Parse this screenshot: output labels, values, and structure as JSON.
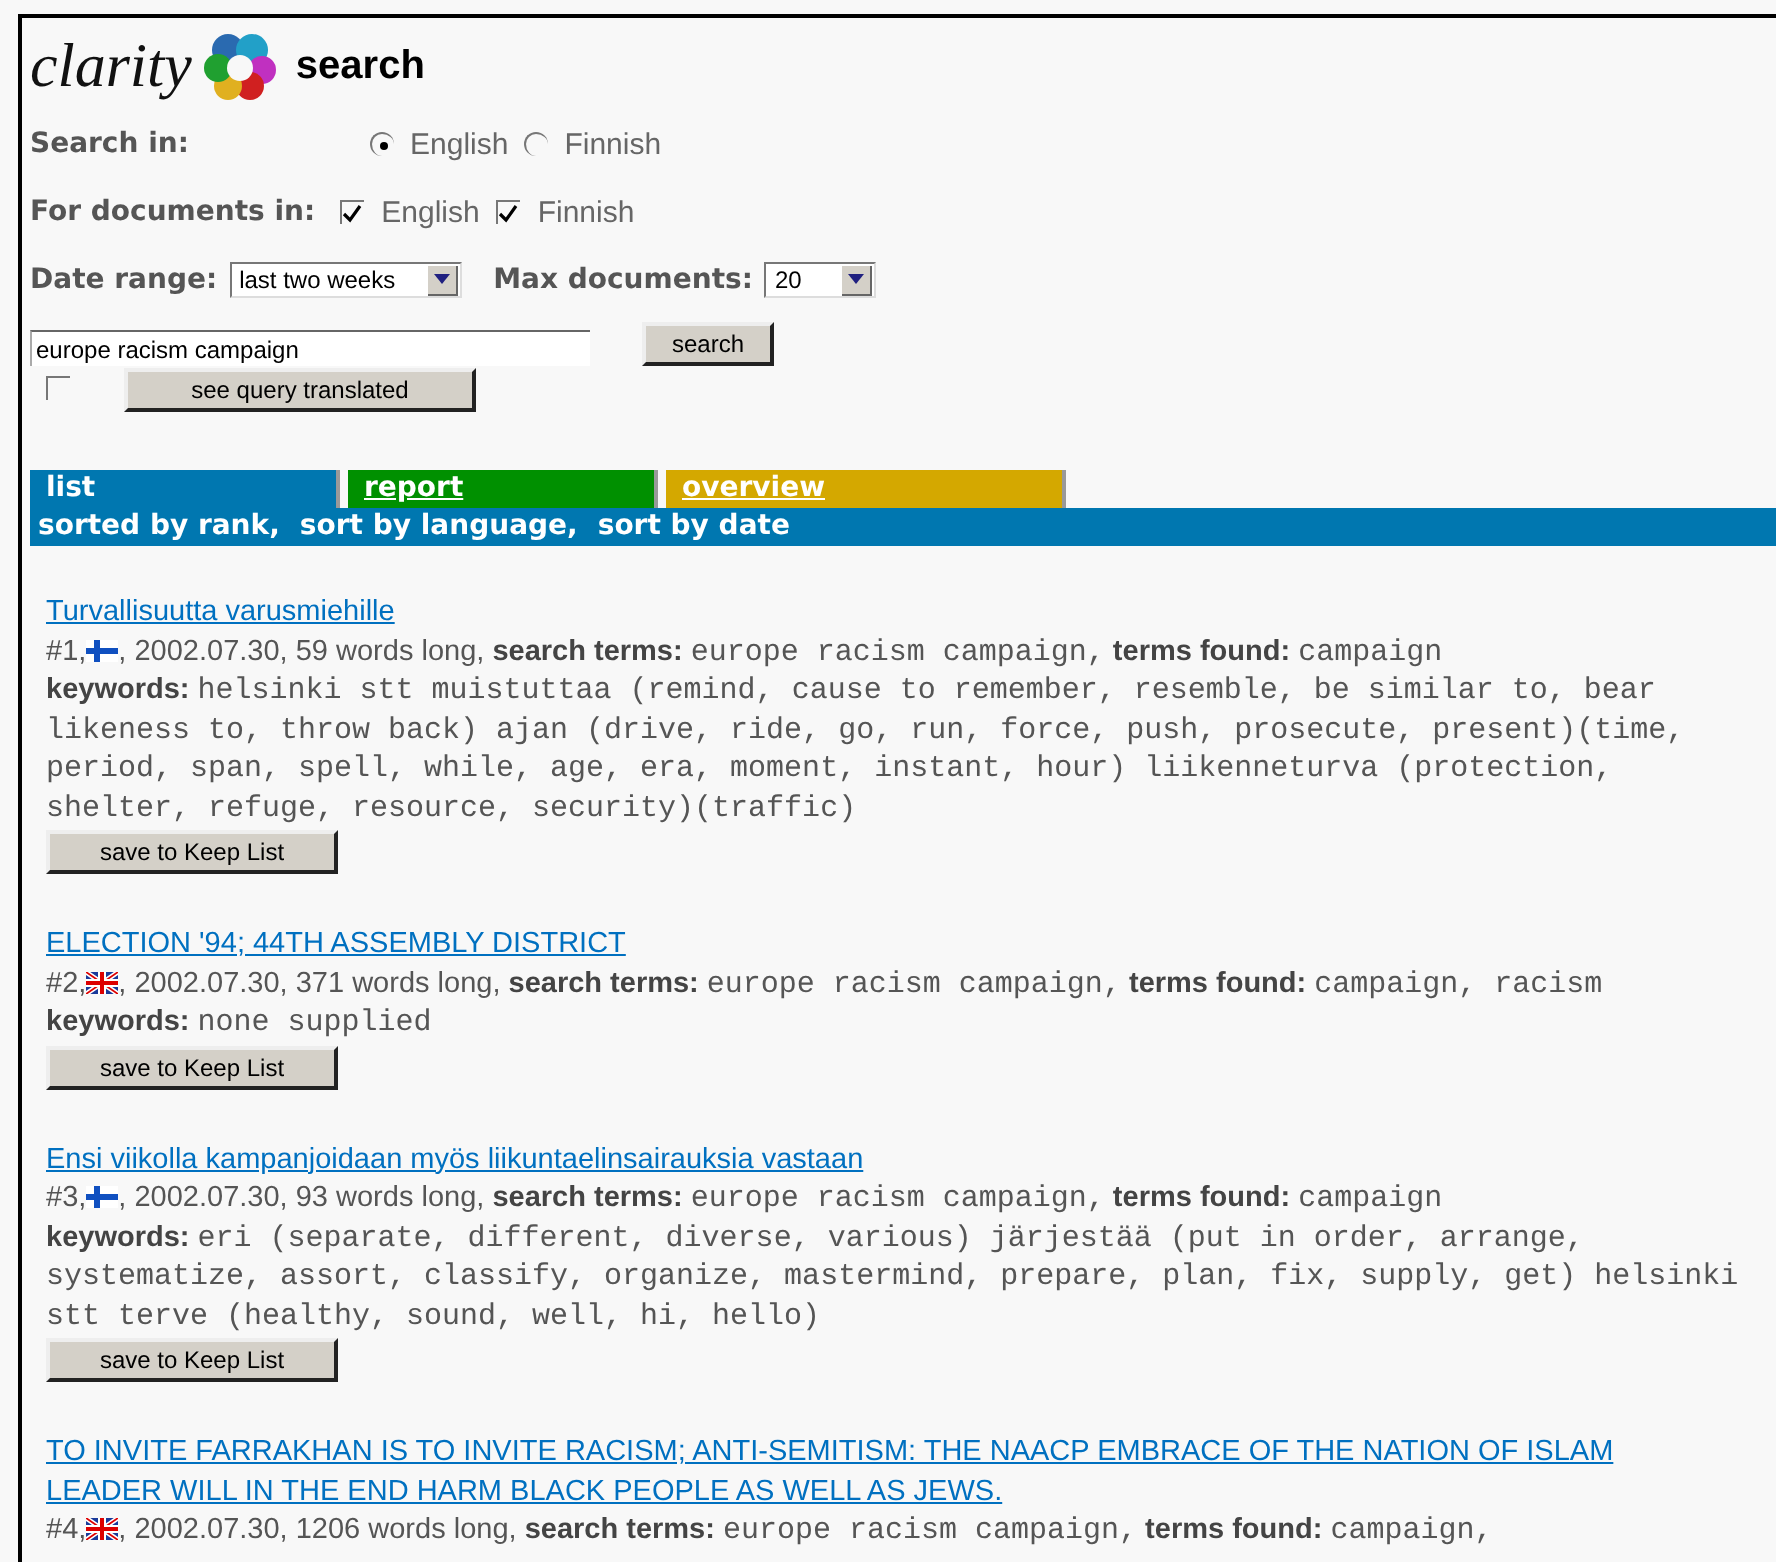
{
  "logo": {
    "wordmark": "clarity",
    "title": "search"
  },
  "search_in": {
    "label": "Search in:",
    "options": [
      {
        "label": "English",
        "selected": true
      },
      {
        "label": "Finnish",
        "selected": false
      }
    ]
  },
  "documents_in": {
    "label": "For documents in:",
    "options": [
      {
        "label": "English",
        "checked": true
      },
      {
        "label": "Finnish",
        "checked": true
      }
    ]
  },
  "date_range": {
    "label": "Date range:",
    "value": "last two weeks"
  },
  "max_documents": {
    "label": "Max documents:",
    "value": "20"
  },
  "query": {
    "value": "europe racism campaign",
    "button": "search"
  },
  "translate": {
    "checked": false,
    "button": "see query translated"
  },
  "tabs": [
    {
      "label": "list",
      "selected": true,
      "color": "#0077b0"
    },
    {
      "label": "report",
      "selected": false,
      "color": "#009000"
    },
    {
      "label": "overview",
      "selected": false,
      "color": "#d4a800"
    }
  ],
  "sort_links": [
    "sorted by rank,",
    "sort by language,",
    "sort by date"
  ],
  "results": [
    {
      "title": "Turvallisuutta varusmiehille",
      "number": "#1,",
      "kind": "fi",
      "details": ", 2002.07.30, 59 words long,",
      "search_terms_label": "search terms:",
      "search_terms": "europe racism campaign,",
      "terms_found_label": "terms found:",
      "terms_found": "campaign",
      "keywords_label": "keywords:",
      "keywords": "helsinki stt muistuttaa (remind, cause to remember, resemble, be similar to, bear likeness to, throw back) ajan (drive, ride, go, run, force, push, prosecute, present)(time, period, span, spell, while, age, era, moment, instant, hour) liikenneturva (protection, shelter, refuge, resource, security)(traffic)",
      "button": "save to Keep List"
    },
    {
      "title": "ELECTION '94; 44TH ASSEMBLY DISTRICT",
      "number": "#2,",
      "kind": "gb",
      "details": ", 2002.07.30, 371 words long,",
      "search_terms_label": "search terms:",
      "search_terms": "europe racism campaign,",
      "terms_found_label": "terms found:",
      "terms_found": "campaign, racism",
      "keywords_label": "keywords:",
      "keywords": "none supplied",
      "button": "save to Keep List"
    },
    {
      "title": "Ensi viikolla kampanjoidaan myös liikuntaelinsairauksia vastaan",
      "number": "#3,",
      "kind": "fi",
      "details": ", 2002.07.30, 93 words long,",
      "search_terms_label": "search terms:",
      "search_terms": "europe racism campaign,",
      "terms_found_label": "terms found:",
      "terms_found": "campaign",
      "keywords_label": "keywords:",
      "keywords": "eri (separate, different, diverse, various) järjestää (put in order, arrange, systematize, assort, classify, organize, mastermind, prepare, plan, fix, supply, get) helsinki stt terve (healthy, sound, well, hi, hello)",
      "button": "save to Keep List"
    },
    {
      "title": "TO INVITE FARRAKHAN IS TO INVITE RACISM; ANTI-SEMITISM: THE NAACP EMBRACE OF THE NATION OF ISLAM LEADER WILL IN THE END HARM BLACK PEOPLE AS WELL AS JEWS.",
      "number": "#4,",
      "kind": "gb",
      "details": ", 2002.07.30, 1206 words long,",
      "search_terms_label": "search terms:",
      "search_terms": "europe racism campaign,",
      "terms_found_label": "terms found:",
      "terms_found": "campaign,"
    }
  ]
}
